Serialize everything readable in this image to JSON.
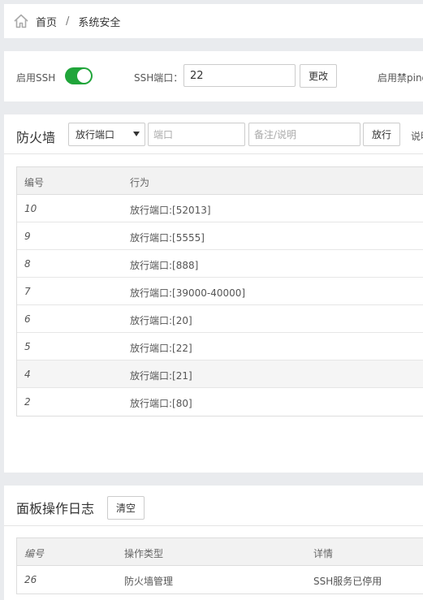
{
  "breadcrumb": {
    "home_icon": "home-icon",
    "home": "首页",
    "separator": "/",
    "current": "系统安全"
  },
  "ssh": {
    "enable_label": "启用SSH",
    "enabled": true,
    "port_label": "SSH端口：",
    "port_value": "22",
    "change_button": "更改",
    "ping_label": "启用禁ping"
  },
  "firewall": {
    "title": "防火墙",
    "mode_selected": "放行端口",
    "port_placeholder": "端口",
    "note_placeholder": "备注/说明",
    "allow_button": "放行",
    "explain_label": "说明",
    "columns": [
      "编号",
      "行为"
    ],
    "rows": [
      {
        "id": "10",
        "action": "放行端口:[52013]"
      },
      {
        "id": "9",
        "action": "放行端口:[5555]"
      },
      {
        "id": "8",
        "action": "放行端口:[888]"
      },
      {
        "id": "7",
        "action": "放行端口:[39000-40000]"
      },
      {
        "id": "6",
        "action": "放行端口:[20]"
      },
      {
        "id": "5",
        "action": "放行端口:[22]"
      },
      {
        "id": "4",
        "action": "放行端口:[21]"
      },
      {
        "id": "2",
        "action": "放行端口:[80]"
      }
    ]
  },
  "log": {
    "title": "面板操作日志",
    "clear_button": "清空",
    "columns": [
      "编号",
      "操作类型",
      "详情"
    ],
    "rows": [
      {
        "id": "26",
        "type": "防火墙管理",
        "detail": "SSH服务已停用"
      }
    ]
  },
  "colors": {
    "accent": "#20a53a",
    "background": "#e9ebee"
  }
}
